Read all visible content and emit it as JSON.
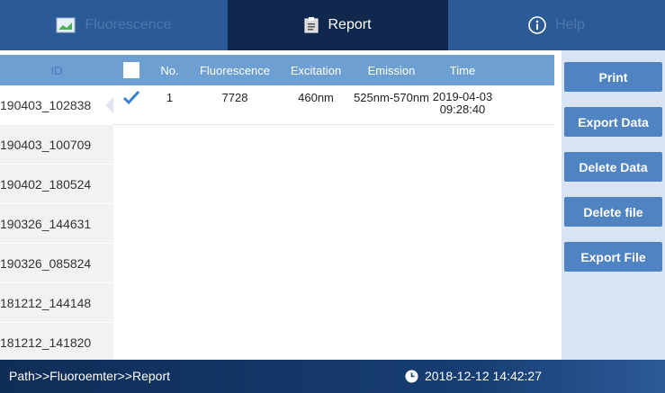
{
  "tabs": {
    "fluorescence": "Fluorescence",
    "report": "Report",
    "help": "Help"
  },
  "id_list": {
    "header": "ID",
    "items": [
      "190403_102838",
      "190403_100709",
      "190402_180524",
      "190326_144631",
      "190326_085824",
      "181212_144148",
      "181212_141820"
    ]
  },
  "table": {
    "headers": {
      "no": "No.",
      "fluorescence": "Fluorescence",
      "excitation": "Excitation",
      "emission": "Emission",
      "time": "Time"
    },
    "rows": [
      {
        "checked": true,
        "no": "1",
        "fluorescence": "7728",
        "excitation": "460nm",
        "emission": "525nm-570nm",
        "time_date": "2019-04-03",
        "time_clock": "09:28:40"
      }
    ]
  },
  "buttons": {
    "print": "Print",
    "export_data": "Export Data",
    "delete_data": "Delete Data",
    "delete_file": "Delete file",
    "export_file": "Export File"
  },
  "status": {
    "path": "Path>>Fluoroemter>>Report",
    "datetime": "2018-12-12 14:42:27"
  },
  "colors": {
    "header_blue": "#6e9fd3",
    "button_blue": "#4f83c1",
    "active_tab": "#10284d"
  }
}
